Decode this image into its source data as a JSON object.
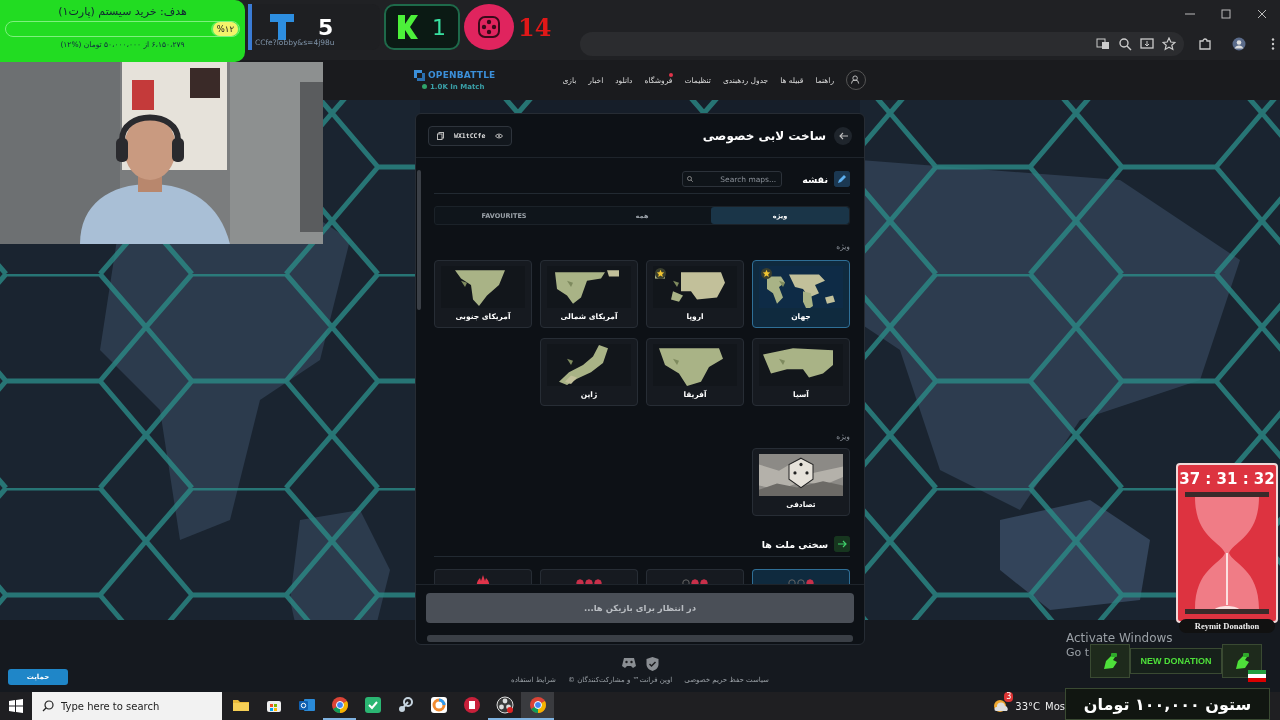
{
  "stream_overlay": {
    "goal": {
      "title": "هدف: خرید سیستم (پارت۱)",
      "percent": "%۱۲",
      "level": 0.12,
      "detail": "۶،۱۵۰،۲۷۹ از ۵۰،۰۰۰،۰۰۰ تومان (%۱۲)"
    },
    "url_fragment": "CCfe?lobby&s=4j98u",
    "scores": [
      {
        "kind": "reel",
        "value": "14"
      },
      {
        "kind": "k",
        "value": "1"
      },
      {
        "kind": "t",
        "value": "5"
      }
    ],
    "timer": {
      "time": "37 : 31 : 32",
      "label": "Reymit Donathon"
    },
    "donation": {
      "title": "NEW DONATION",
      "amount": "ستون ۱۰۰,۰۰۰ تومان"
    }
  },
  "nav": {
    "logo": "OPENBATTLE",
    "online": "1.0K In Match",
    "items": [
      {
        "label": "راهنما",
        "notify": false
      },
      {
        "label": "قبیله ها",
        "notify": false
      },
      {
        "label": "جدول ردهبندی",
        "notify": false
      },
      {
        "label": "تنظیمات",
        "notify": false
      },
      {
        "label": "فروشگاه",
        "notify": true
      },
      {
        "label": "دانلود",
        "notify": false
      },
      {
        "label": "اخبار",
        "notify": false
      },
      {
        "label": "بازی",
        "notify": false
      }
    ]
  },
  "lobby": {
    "title": "ساخت لابی خصوصی",
    "code": "WX1tCCfe",
    "map_section": {
      "title": "نقشه",
      "search": {
        "placeholder": "Search maps..."
      },
      "tabs": [
        {
          "label": "ویژه",
          "selected": true
        },
        {
          "label": "همه",
          "selected": false
        },
        {
          "label": "FAVOURITES",
          "selected": false
        }
      ],
      "groups": [
        {
          "label": "ویژه",
          "maps": [
            {
              "name": "جهان",
              "kind": "map",
              "selected": true,
              "favourite": true
            },
            {
              "name": "اروپا",
              "kind": "map",
              "selected": false,
              "favourite": true
            },
            {
              "name": "آمریکای شمالی",
              "kind": "map",
              "selected": false,
              "favourite": false
            },
            {
              "name": "آمریکای جنوبی",
              "kind": "map",
              "selected": false,
              "favourite": false
            },
            {
              "name": "آسیا",
              "kind": "map",
              "selected": false,
              "favourite": false
            },
            {
              "name": "آفریقا",
              "kind": "map",
              "selected": false,
              "favourite": false
            },
            {
              "name": "ژاپن",
              "kind": "map",
              "selected": false,
              "favourite": false
            }
          ]
        },
        {
          "label": "ویژه",
          "maps": [
            {
              "name": "تصادفی",
              "kind": "random",
              "selected": false,
              "favourite": false
            }
          ]
        }
      ]
    },
    "difficulty": {
      "title": "سختی ملت ها",
      "options": [
        {
          "kind": "easy",
          "selected": true
        },
        {
          "kind": "medium",
          "selected": false
        },
        {
          "kind": "hard",
          "selected": false
        },
        {
          "kind": "impossible",
          "selected": false
        }
      ]
    },
    "wait_button": {
      "label": "در انتظار برای بازیکن ها...",
      "disabled": true
    }
  },
  "footer": {
    "links": [
      "سیاست حفظ حریم خصوصی",
      "اوپن فرانت™ و مشارکت‌کنندگان ©",
      "شرایط استفاده"
    ]
  },
  "support_button": "حمایت",
  "system": {
    "activation": [
      "Activate Windows",
      "Go t"
    ],
    "taskbar": {
      "search_placeholder": "Type here to search",
      "apps": [
        {
          "kind": "folder",
          "running": false,
          "active": false
        },
        {
          "kind": "store",
          "running": false,
          "active": false
        },
        {
          "kind": "mail",
          "running": false,
          "active": false
        },
        {
          "kind": "browser",
          "running": true,
          "active": false
        },
        {
          "kind": "shield",
          "running": false,
          "active": false
        },
        {
          "kind": "piston",
          "running": false,
          "active": false
        },
        {
          "kind": "ring",
          "running": false,
          "active": false
        },
        {
          "kind": "red",
          "running": false,
          "active": false
        },
        {
          "kind": "obs",
          "running": true,
          "active": false
        },
        {
          "kind": "browser",
          "running": true,
          "active": true
        }
      ],
      "weather": {
        "badge": "3",
        "temp": "33°C",
        "label": "Mos"
      }
    }
  }
}
